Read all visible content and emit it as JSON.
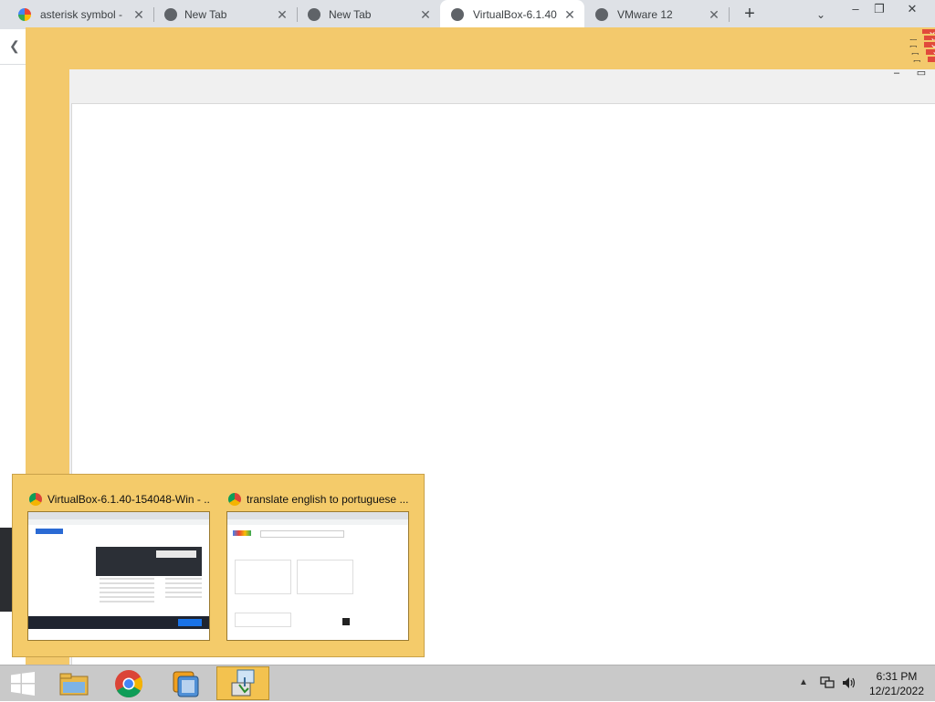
{
  "browser": {
    "tabs": [
      {
        "title": "asterisk symbol -",
        "icon": "google-icon",
        "active": false
      },
      {
        "title": "New Tab",
        "icon": "chrome-newtab-icon",
        "active": false
      },
      {
        "title": "New Tab",
        "icon": "chrome-newtab-icon",
        "active": false
      },
      {
        "title": "VirtualBox-6.1.40",
        "icon": "globe-icon",
        "active": true
      },
      {
        "title": "VMware 12",
        "icon": "globe-icon",
        "active": false
      }
    ],
    "new_tab_glyph": "+",
    "tab_search_glyph": "⌄",
    "tab_close_glyph": "✕",
    "minimize_glyph": "–",
    "restore_glyph": "❐",
    "close_glyph": "✕",
    "back_glyph": "❮"
  },
  "taskbar_preview": {
    "items": [
      {
        "title": "VirtualBox-6.1.40-154048-Win - ...",
        "icon": "chrome-icon"
      },
      {
        "title": "translate english to portuguese ...",
        "icon": "chrome-icon"
      }
    ]
  },
  "taskbar": {
    "apps": [
      {
        "name": "file-explorer",
        "active": false
      },
      {
        "name": "chrome",
        "active": false
      },
      {
        "name": "vmware",
        "active": false
      },
      {
        "name": "installer",
        "active": true
      }
    ],
    "tray_chevron": "▲",
    "clock": {
      "time": "6:31 PM",
      "date": "12/21/2022"
    }
  },
  "colors": {
    "ghost_border": "#f3c96c",
    "taskbar_active": "#f3c24f",
    "close_red": "#e14a3b"
  }
}
